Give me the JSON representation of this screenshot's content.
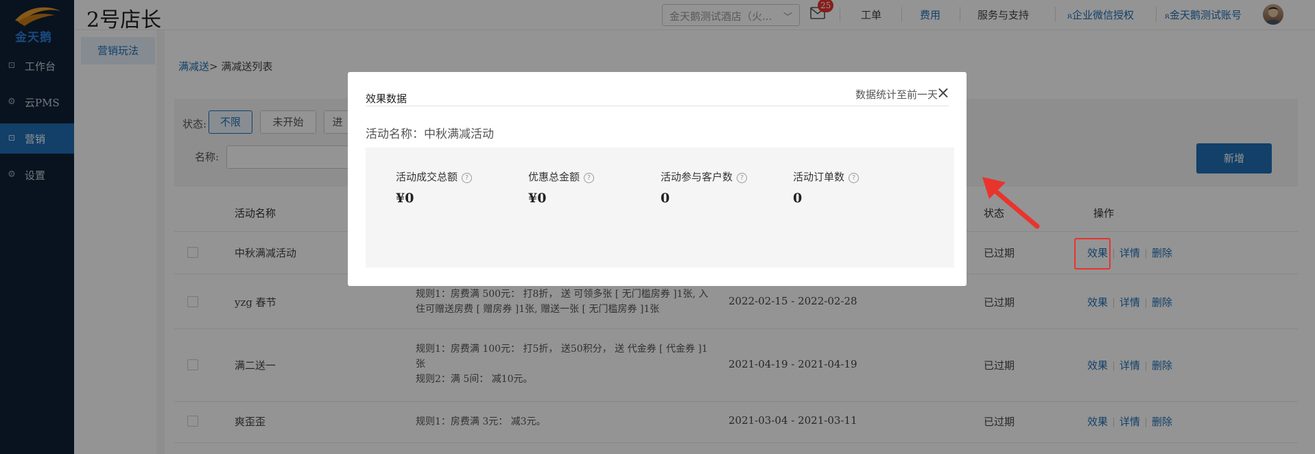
{
  "header": {
    "brand": "2号店长",
    "hotel_select": "金天鹅测试酒店（火...",
    "mail_count": "25",
    "links": {
      "workorder": "工单",
      "fees": "费用",
      "service": "服务与支持",
      "wechat_auth": "企业微信授权",
      "account": "金天鹅测试账号"
    }
  },
  "sidebar": {
    "logo_text": "金天鹅",
    "items": [
      {
        "label": "工作台",
        "active": false
      },
      {
        "label": "云PMS",
        "active": false
      },
      {
        "label": "营销",
        "active": true
      },
      {
        "label": "设置",
        "active": false
      }
    ]
  },
  "subnav": {
    "item": "营销玩法"
  },
  "breadcrumb": {
    "link": "满减送",
    "current": "> 满减送列表"
  },
  "filters": {
    "status_label": "状态:",
    "chips": [
      "不限",
      "未开始",
      "进"
    ],
    "name_label": "名称:"
  },
  "add_button": "新增",
  "table": {
    "headers": {
      "name": "活动名称",
      "status": "状态",
      "ops": "操作"
    },
    "rows": [
      {
        "name": "中秋满减活动",
        "rules": [],
        "period": "",
        "status": "已过期"
      },
      {
        "name": "yzg 春节",
        "rules": [
          "规则1：房费满 500元： 打8折， 送 可领多张 [ 无门槛房券 ]1张, 入住可赠送房费 [ 赠房券 ]1张, 赠送一张 [ 无门槛房券 ]1张"
        ],
        "period": "2022-02-15 - 2022-02-28",
        "status": "已过期"
      },
      {
        "name": "满二送一",
        "rules": [
          "规则1：房费满 100元： 打5折， 送50积分， 送 代金券 [ 代金券 ]1张",
          "规则2：满 5间： 减10元。"
        ],
        "period": "2021-04-19 - 2021-04-19",
        "status": "已过期"
      },
      {
        "name": "爽歪歪",
        "rules": [
          "规则1：房费满 3元： 减3元。"
        ],
        "period": "2021-03-04 - 2021-03-11",
        "status": "已过期"
      }
    ],
    "ops": {
      "effect": "效果",
      "detail": "详情",
      "delete": "删除"
    }
  },
  "modal": {
    "title": "效果数据",
    "note": "数据统计至前一天",
    "activity_label": "活动名称：中秋满减活动",
    "stats": [
      {
        "label": "活动成交总额",
        "value": "¥0"
      },
      {
        "label": "优惠总金额",
        "value": "¥0"
      },
      {
        "label": "活动参与客户数",
        "value": "0"
      },
      {
        "label": "活动订单数",
        "value": "0"
      }
    ]
  },
  "colors": {
    "accent": "#1f6fb5",
    "sidebar": "#0e2236",
    "highlight": "#e8342d"
  }
}
